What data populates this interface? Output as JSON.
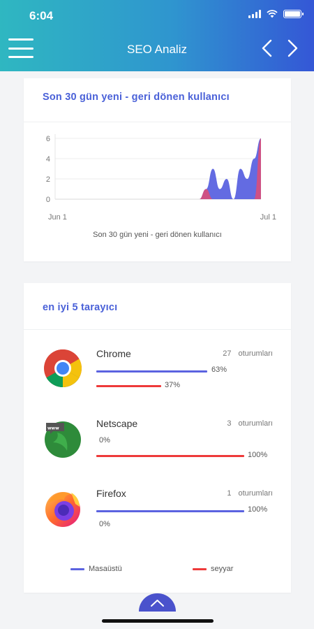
{
  "status_bar": {
    "time": "6:04"
  },
  "header": {
    "title": "SEO Analiz"
  },
  "traffic_card": {
    "title": "Son 30 gün yeni - geri dönen kullanıcı",
    "caption": "Son 30 gün yeni - geri dönen kullanıcı",
    "chart_data": {
      "type": "area",
      "x_tick_labels": [
        "Jun 1",
        "Jul 1"
      ],
      "y_ticks": [
        0,
        2,
        4,
        6
      ],
      "ylim": [
        0,
        6
      ],
      "grid": true,
      "legend": "none",
      "x": [
        0,
        21,
        22,
        23,
        24,
        25,
        26,
        27,
        28,
        29,
        30
      ],
      "series": [
        {
          "color": "#5b63e0",
          "values": [
            0,
            0,
            1,
            3,
            1,
            2,
            0,
            3,
            2,
            4,
            6
          ]
        },
        {
          "color": "#d94f7a",
          "values": [
            0,
            0,
            1,
            0,
            0,
            0,
            0,
            0,
            0,
            0,
            6
          ]
        }
      ]
    }
  },
  "browsers_card": {
    "title": "en iyi 5 tarayıcı",
    "browsers": [
      {
        "name": "Chrome",
        "icon": "chrome-icon",
        "sessions": "27",
        "sessions_label": "oturumları",
        "desktop_pct": 63,
        "desktop_label": "63%",
        "mobile_pct": 37,
        "mobile_label": "37%"
      },
      {
        "name": "Netscape",
        "icon": "netscape-icon",
        "sessions": "3",
        "sessions_label": "oturumları",
        "desktop_pct": 0,
        "desktop_label": "0%",
        "mobile_pct": 100,
        "mobile_label": "100%"
      },
      {
        "name": "Firefox",
        "icon": "firefox-icon",
        "sessions": "1",
        "sessions_label": "oturumları",
        "desktop_pct": 100,
        "desktop_label": "100%",
        "mobile_pct": 0,
        "mobile_label": "0%"
      }
    ],
    "legend": {
      "desktop": "Masaüstü",
      "mobile": "seyyar",
      "desktop_color": "#5b63e0",
      "mobile_color": "#ee3a3a"
    }
  }
}
